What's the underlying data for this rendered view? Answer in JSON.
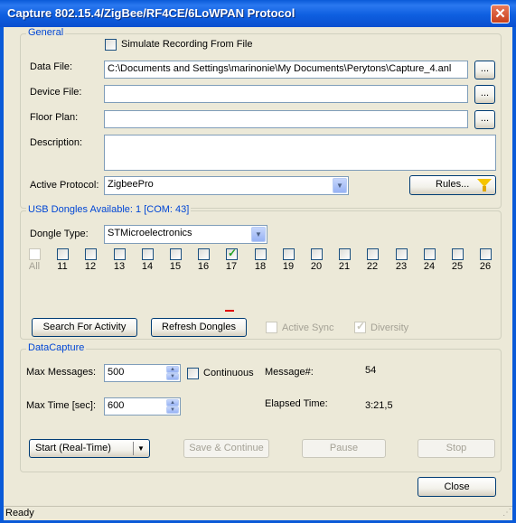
{
  "window": {
    "title": "Capture 802.15.4/ZigBee/RF4CE/6LoWPAN Protocol",
    "close_glyph": "✕"
  },
  "general": {
    "legend": "General",
    "simulate_label": "Simulate Recording From File",
    "data_file_label": "Data File:",
    "data_file_value": "C:\\Documents and Settings\\marinonie\\My Documents\\Perytons\\Capture_4.anl",
    "device_file_label": "Device File:",
    "device_file_value": "",
    "floor_plan_label": "Floor Plan:",
    "floor_plan_value": "",
    "description_label": "Description:",
    "description_value": "",
    "browse_label": "...",
    "active_protocol_label": "Active Protocol:",
    "active_protocol_value": "ZigbeePro",
    "rules_label": "Rules..."
  },
  "usb": {
    "legend": "USB Dongles Available:  1 [COM: 43]",
    "dongle_type_label": "Dongle Type:",
    "dongle_type_value": "STMicroelectronics",
    "channels": [
      {
        "label": "All",
        "checked": false,
        "disabled": true
      },
      {
        "label": "11",
        "checked": false
      },
      {
        "label": "12",
        "checked": false
      },
      {
        "label": "13",
        "checked": false
      },
      {
        "label": "14",
        "checked": false
      },
      {
        "label": "15",
        "checked": false
      },
      {
        "label": "16",
        "checked": false
      },
      {
        "label": "17",
        "checked": true
      },
      {
        "label": "18",
        "checked": false
      },
      {
        "label": "19",
        "checked": false
      },
      {
        "label": "20",
        "checked": false
      },
      {
        "label": "21",
        "checked": false
      },
      {
        "label": "22",
        "checked": false
      },
      {
        "label": "23",
        "checked": false
      },
      {
        "label": "24",
        "checked": false
      },
      {
        "label": "25",
        "checked": false
      },
      {
        "label": "26",
        "checked": false
      }
    ],
    "activity_channel": "17",
    "search_label": "Search For Activity",
    "refresh_label": "Refresh Dongles",
    "active_sync_label": "Active Sync",
    "diversity_label": "Diversity",
    "diversity_checked": true
  },
  "capture": {
    "legend": "DataCapture",
    "max_messages_label": "Max Messages:",
    "max_messages_value": "500",
    "continuous_label": "Continuous",
    "message_num_label": "Message#:",
    "message_num_value": "54",
    "max_time_label": "Max Time [sec]:",
    "max_time_value": "600",
    "elapsed_label": "Elapsed Time:",
    "elapsed_value": "3:21,5",
    "start_label": "Start (Real-Time)",
    "save_continue_label": "Save & Continue",
    "pause_label": "Pause",
    "stop_label": "Stop"
  },
  "close_label": "Close",
  "status": "Ready"
}
